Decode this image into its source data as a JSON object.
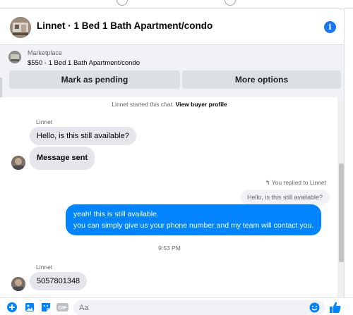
{
  "header": {
    "title": "Linnet · 1 Bed 1 Bath Apartment/condo",
    "info_glyph": "i"
  },
  "listing": {
    "kicker": "Marketplace",
    "title": "$550 - 1 Bed 1 Bath Apartment/condo",
    "mark_pending_label": "Mark as pending",
    "more_options_label": "More options"
  },
  "chat": {
    "system_prefix": "Linnet started this chat.",
    "system_link": "View buyer profile",
    "messages": [
      {
        "sender": "Linnet",
        "text": "Hello, is this still available?"
      },
      {
        "text": "Message sent"
      }
    ],
    "replied_label": "You replied to Linnet",
    "quoted_text": "Hello, is this still available?",
    "reply_line1": "yeah! this is still available.",
    "reply_line2": "you can simply give us your phone number and  my team will contact you.",
    "timestamp": "9:53 PM",
    "last_sender": "Linnet",
    "last_text": "5057801348"
  },
  "composer": {
    "placeholder": "Aa",
    "gif_label": "GIF"
  },
  "colors": {
    "accent": "#0084ff",
    "brand_blue": "#1877f2",
    "incoming_bubble": "#e4e6eb"
  },
  "icons": [
    "plus-circle-icon",
    "photo-icon",
    "sticker-icon",
    "gif-icon",
    "emoji-icon",
    "like-thumb-icon",
    "info-icon",
    "reply-arrow-icon"
  ]
}
